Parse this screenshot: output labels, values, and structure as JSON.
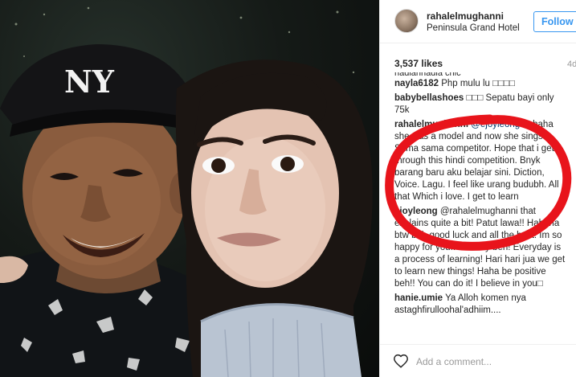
{
  "post": {
    "username": "rahalelmughanni",
    "location": "Peninsula Grand Hotel",
    "follow_label": "Follow",
    "likes": "3,537 likes",
    "time": "4d",
    "comments": [
      {
        "user": "nayla6182",
        "text": " Php mulu lu □□□□"
      },
      {
        "user": "babybellashoes",
        "text": " □□□ Sepatu bayi only 75k"
      },
      {
        "user": "rahalelmughanni",
        "mention": " @ejoyleong",
        "text": " hahaha she was a model and now she sings! Sama sama competitor. Hope that i get through this hindi competition. Bnyk barang baru aku belajar sini. Diction, Voice. Lagu. I feel like urang budubh. All that Which i love. I get to learn"
      },
      {
        "user": "ejoyleong",
        "text": " @rahalelmughanni that explains quite a bit! Patut lawa!! Hahaha btw beh good luck and all the best! Im so happy for you!! Its okay beh! Everyday is a process of learning! Hari hari jua we get to learn new things! Haha be positive beh!! You can do it! I believe in you□"
      },
      {
        "user": "hanie.umie",
        "text": " Ya Alloh komen nya astaghfirulloohal'adhiim...."
      }
    ],
    "add_comment_placeholder": "Add a comment..."
  },
  "colors": {
    "accent": "#3897f0",
    "annotation": "#e8141b",
    "text": "#262626",
    "muted": "#999999"
  },
  "icons": {
    "heart": "heart-icon",
    "cap_logo": "ny-logo"
  }
}
